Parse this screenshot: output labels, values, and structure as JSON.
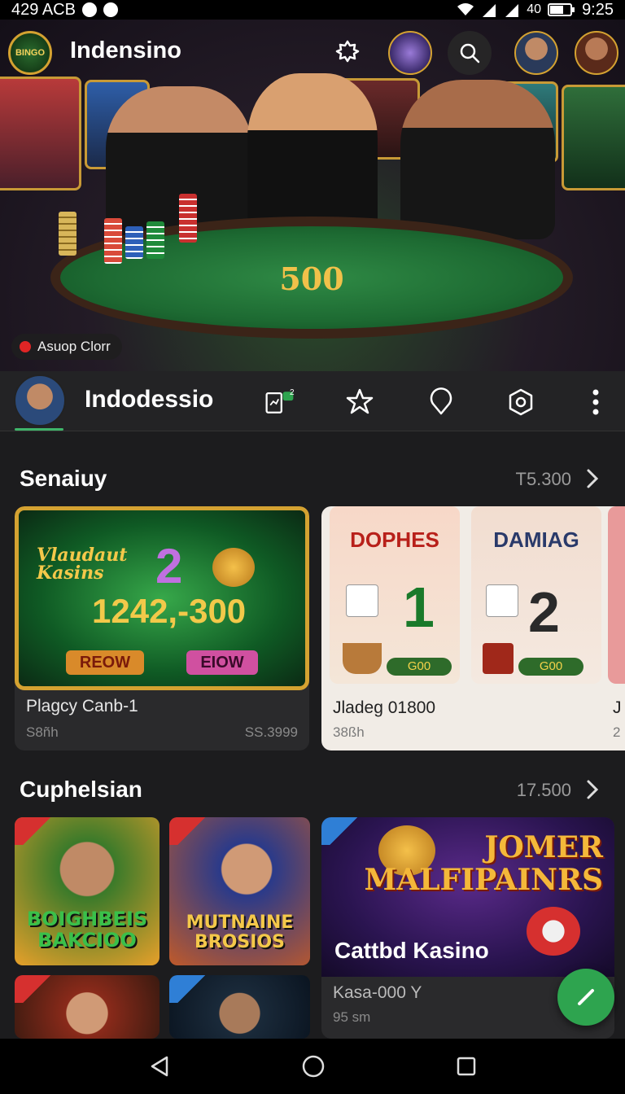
{
  "status_bar": {
    "left_text": "429 ACB",
    "battery_text": "40",
    "time": "9:25"
  },
  "top_bar": {
    "logo_text": "BINGO",
    "title": "Indensino"
  },
  "hero": {
    "table_number": "500",
    "live_label": "Asuop Clorr"
  },
  "profile": {
    "name": "Indodessio",
    "notification_badge": "2"
  },
  "section1": {
    "title": "Senaiuy",
    "count": "T5.300",
    "featured": {
      "headline": "Vlaudaut Kasins",
      "big_number": "2",
      "jackpot": "1242,-300",
      "button_left": "REOW",
      "button_right": "EIOW",
      "caption_title": "Plagcy Canb-1",
      "caption_sub": "S8ñh",
      "caption_right": "SS.3999"
    },
    "card2": {
      "header": "DOPHES",
      "number": "1",
      "chip_value": "G00",
      "caption_title": "Jladeg 01800",
      "caption_sub": "38ßh"
    },
    "card3": {
      "header": "DAMIAG",
      "number": "2",
      "chip_value": "G00"
    },
    "card4": {
      "caption_title": "J",
      "caption_sub": "2"
    }
  },
  "section2": {
    "title": "Cuphelsian",
    "count": "17.500",
    "thumbs": [
      {
        "text": "BOIGHBEIS BAKCIOO"
      },
      {
        "text": "MUTNAINE BROSIOS"
      }
    ],
    "wide_card": {
      "headline": "JOMER MALFIPAINRS",
      "overlay_title": "Cattbd Kasino",
      "caption_title": "Kasa-000 Y",
      "caption_sub": "95 sm"
    }
  },
  "colors": {
    "accent_green": "#2ea44f",
    "gold": "#d4a231",
    "background": "#1c1c1e"
  },
  "icons": [
    "signal-icon",
    "wifi-icon",
    "battery-icon",
    "settings-icon",
    "search-icon",
    "wallet-icon",
    "favorites-icon",
    "location-icon",
    "shield-icon",
    "more-icon",
    "chevron-right-icon",
    "edit-icon",
    "back-icon",
    "home-icon",
    "recents-icon"
  ]
}
